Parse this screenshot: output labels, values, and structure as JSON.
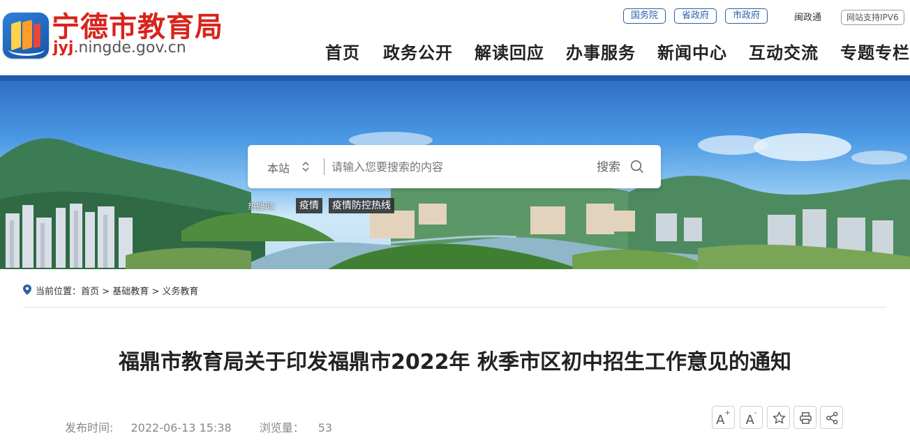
{
  "header": {
    "site_title": "宁德市教育局",
    "domain_highlight": "jyj",
    "domain_rest": ".ningde.gov.cn",
    "top_links": [
      "国务院",
      "省政府",
      "市政府"
    ],
    "min_zheng_tong": "闽政通",
    "ipv6_badge": "网站支持IPV6",
    "nav": [
      "首页",
      "政务公开",
      "解读回应",
      "办事服务",
      "新闻中心",
      "互动交流",
      "专题专栏"
    ]
  },
  "search": {
    "scope": "本站",
    "placeholder": "请输入您要搜索的内容",
    "button": "搜索",
    "hot_label": "热搜词：",
    "hot_words": [
      "疫情",
      "疫情防控热线"
    ]
  },
  "breadcrumb": {
    "label": "当前位置：",
    "items": [
      "首页",
      "基础教育",
      "义务教育"
    ],
    "separator": " > "
  },
  "article": {
    "title": "福鼎市教育局关于印发福鼎市2022年 秋季市区初中招生工作意见的通知",
    "publish_label": "发布时间:",
    "publish_time": "2022-06-13 15:38",
    "views_label": "浏览量：",
    "views": "53"
  },
  "tools": {
    "font_larger": "A",
    "font_smaller": "A",
    "plus": "+",
    "minus": "-"
  },
  "colors": {
    "brand_red": "#d8241c",
    "brand_blue": "#1e5aa8"
  },
  "icons": [
    "logo-icon",
    "chevron-updown-icon",
    "search-icon",
    "location-pin-icon",
    "star-icon",
    "print-icon",
    "share-icon"
  ]
}
